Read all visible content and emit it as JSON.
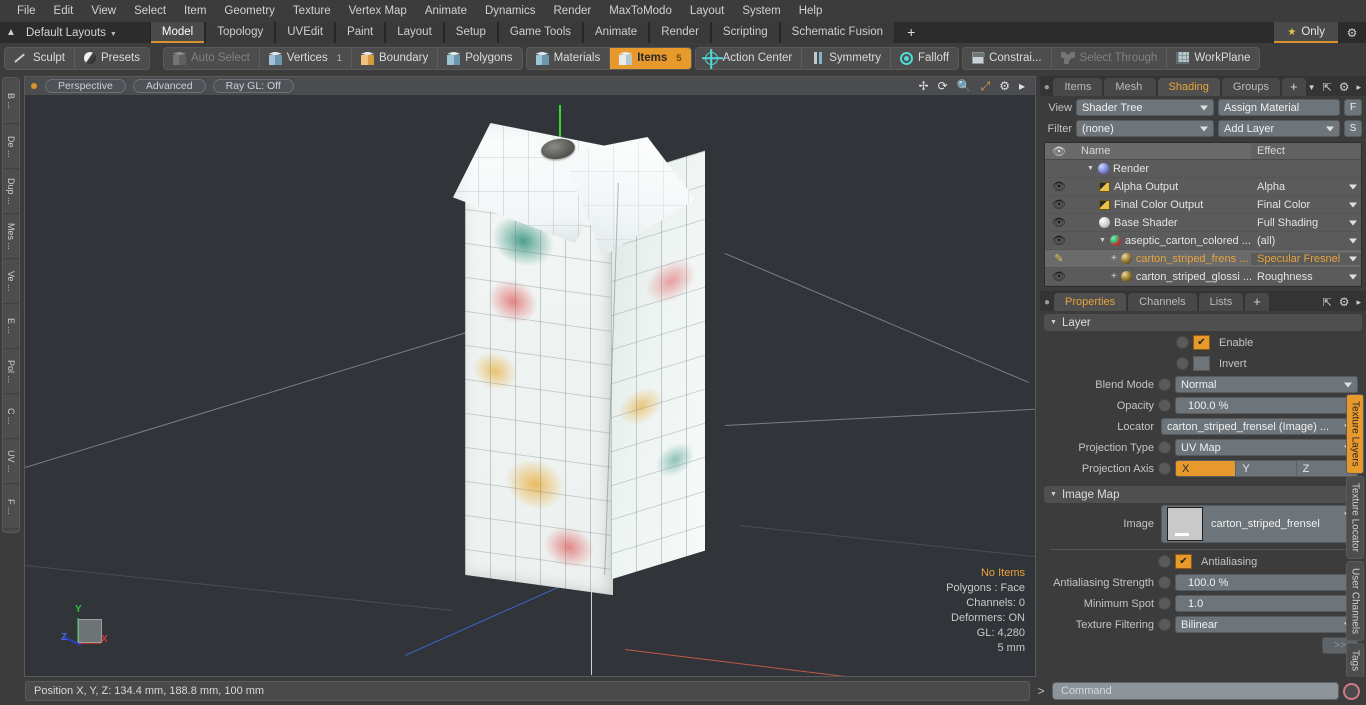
{
  "menu": {
    "items": [
      "File",
      "Edit",
      "View",
      "Select",
      "Item",
      "Geometry",
      "Texture",
      "Vertex Map",
      "Animate",
      "Dynamics",
      "Render",
      "MaxToModo",
      "Layout",
      "System",
      "Help"
    ]
  },
  "layout_bar": {
    "home_icon": "home-icon",
    "layouts_label": "Default Layouts",
    "tabs": [
      {
        "label": "Model",
        "selected": true
      },
      {
        "label": "Topology",
        "selected": false
      },
      {
        "label": "UVEdit",
        "selected": false
      },
      {
        "label": "Paint",
        "selected": false
      },
      {
        "label": "Layout",
        "selected": false
      },
      {
        "label": "Setup",
        "selected": false
      },
      {
        "label": "Game Tools",
        "selected": false
      },
      {
        "label": "Animate",
        "selected": false
      },
      {
        "label": "Render",
        "selected": false
      },
      {
        "label": "Scripting",
        "selected": false
      },
      {
        "label": "Schematic Fusion",
        "selected": false
      }
    ],
    "add_tab": "+",
    "only_label": "Only",
    "gear_icon": "gear-icon"
  },
  "toolbar": {
    "group1": [
      {
        "label": "Sculpt",
        "icon": "sculpt-icon",
        "dim": false,
        "active": false
      },
      {
        "label": "Presets",
        "icon": "presets-sphere-icon",
        "dim": false,
        "active": false
      }
    ],
    "group2": [
      {
        "label": "Auto Select",
        "icon": "cube-gray-icon",
        "dim": true,
        "active": false,
        "count": ""
      },
      {
        "label": "Vertices",
        "icon": "cube-blue-icon",
        "dim": false,
        "active": false,
        "count": "1"
      },
      {
        "label": "Boundary",
        "icon": "cube-orange-icon",
        "dim": false,
        "active": false,
        "count": ""
      },
      {
        "label": "Polygons",
        "icon": "cube-blue-icon",
        "dim": false,
        "active": false,
        "count": ""
      }
    ],
    "group3": [
      {
        "label": "Materials",
        "icon": "cube-blue-icon",
        "dim": false,
        "active": false,
        "count": ""
      },
      {
        "label": "Items",
        "icon": "cube-white-icon",
        "dim": false,
        "active": true,
        "count": "5"
      }
    ],
    "group4": [
      {
        "label": "Action Center",
        "icon": "action-center-icon",
        "dim": false,
        "active": false
      },
      {
        "label": "Symmetry",
        "icon": "symmetry-icon",
        "dim": false,
        "active": false
      },
      {
        "label": "Falloff",
        "icon": "falloff-icon",
        "dim": false,
        "active": false
      }
    ],
    "group5": [
      {
        "label": "Constrai...",
        "icon": "constraint-icon",
        "dim": false,
        "active": false
      },
      {
        "label": "Select Through",
        "icon": "select-through-icon",
        "dim": true,
        "active": false
      },
      {
        "label": "WorkPlane",
        "icon": "workplane-icon",
        "dim": false,
        "active": false
      }
    ]
  },
  "left_rail": {
    "tabs": [
      "B ...",
      "De ...",
      "Dup ...",
      "Mes ...",
      "Ve ...",
      "E ...",
      "Pol ...",
      "C ...",
      "UV ...",
      "F ..."
    ]
  },
  "viewport": {
    "pills": [
      "Perspective",
      "Advanced",
      "Ray GL: Off"
    ],
    "icons": [
      "move-icon",
      "rotate-icon",
      "zoom-icon",
      "fit-icon",
      "gear-icon",
      "arrow-right-icon"
    ],
    "gizmo": {
      "x": "X",
      "y": "Y",
      "z": "Z"
    },
    "stats": [
      "No Items",
      "Polygons : Face",
      "Channels: 0",
      "Deformers: ON",
      "GL: 4,280",
      "5 mm"
    ]
  },
  "right_panel": {
    "tabs": [
      {
        "label": "Items",
        "selected": false
      },
      {
        "label": "Mesh ...",
        "selected": false
      },
      {
        "label": "Shading",
        "selected": true
      },
      {
        "label": "Groups",
        "selected": false
      }
    ],
    "add_tab": "+",
    "view_label": "View",
    "view_value": "Shader Tree",
    "assign_material": "Assign Material",
    "assign_btn": "F",
    "filter_label": "Filter",
    "filter_value": "(none)",
    "add_layer": "Add Layer",
    "add_layer_btn": "S",
    "tree_headers": {
      "eye": "eye-icon",
      "name": "Name",
      "effect": "Effect"
    },
    "tree_rows": [
      {
        "name": "Render",
        "effect": "",
        "indent": 1,
        "icon": "render-sphere-icon",
        "eye": false,
        "expand": true,
        "selected": false
      },
      {
        "name": "Alpha Output",
        "effect": "Alpha",
        "indent": 2,
        "icon": "image-output-icon",
        "eye": true,
        "expand": false,
        "selected": false
      },
      {
        "name": "Final Color Output",
        "effect": "Final Color",
        "indent": 2,
        "icon": "image-output-icon",
        "eye": true,
        "expand": false,
        "selected": false
      },
      {
        "name": "Base Shader",
        "effect": "Full Shading",
        "indent": 2,
        "icon": "base-shader-icon",
        "eye": true,
        "expand": false,
        "selected": false
      },
      {
        "name": "aseptic_carton_colored ...",
        "effect": "(all)",
        "indent": 2,
        "icon": "material-icon",
        "eye": true,
        "expand": true,
        "selected": false
      },
      {
        "name": "carton_striped_frens ...",
        "effect": "Specular Fresnel",
        "indent": 3,
        "icon": "texture-icon",
        "eye": false,
        "expand": false,
        "selected": true
      },
      {
        "name": "carton_striped_glossi ...",
        "effect": "Roughness",
        "indent": 3,
        "icon": "texture-icon",
        "eye": true,
        "expand": false,
        "selected": false
      }
    ]
  },
  "properties": {
    "tabs": [
      {
        "label": "Properties",
        "selected": true
      },
      {
        "label": "Channels",
        "selected": false
      },
      {
        "label": "Lists",
        "selected": false
      }
    ],
    "add_tab": "+",
    "layer_section": "Layer",
    "enable_label": "Enable",
    "enable_checked": true,
    "invert_label": "Invert",
    "invert_checked": false,
    "blend_mode_label": "Blend Mode",
    "blend_mode_value": "Normal",
    "opacity_label": "Opacity",
    "opacity_value": "100.0 %",
    "locator_label": "Locator",
    "locator_value": "carton_striped_frensel (Image) ...",
    "projection_type_label": "Projection Type",
    "projection_type_value": "UV Map",
    "projection_axis_label": "Projection Axis",
    "projection_axis": [
      "X",
      "Y",
      "Z"
    ],
    "projection_axis_selected": "X",
    "image_map_section": "Image Map",
    "image_label": "Image",
    "image_value": "carton_striped_frensel",
    "antialiasing_label": "Antialiasing",
    "antialiasing_checked": true,
    "aa_strength_label": "Antialiasing Strength",
    "aa_strength_value": "100.0 %",
    "min_spot_label": "Minimum Spot",
    "min_spot_value": "1.0",
    "tex_filter_label": "Texture Filtering",
    "tex_filter_value": "Bilinear",
    "more_btn": ">>"
  },
  "right_rail": {
    "tabs": [
      {
        "label": "Texture Layers",
        "selected": true
      },
      {
        "label": "Texture Locator",
        "selected": false
      },
      {
        "label": "User Channels",
        "selected": false
      },
      {
        "label": "Tags",
        "selected": false
      }
    ]
  },
  "bottom": {
    "status_text": "Position X, Y, Z:   134.4 mm, 188.8 mm, 100 mm",
    "prompt": ">",
    "command_placeholder": "Command",
    "record_icon": "record-icon"
  },
  "colors": {
    "accent": "#e8992b",
    "panel": "#3c3c3c",
    "viewport_bg": "#313539",
    "control": "#6e757a",
    "axis_x": "#c05a4a",
    "axis_z": "#3f63c8",
    "axis_y": "#2fdc2f"
  }
}
